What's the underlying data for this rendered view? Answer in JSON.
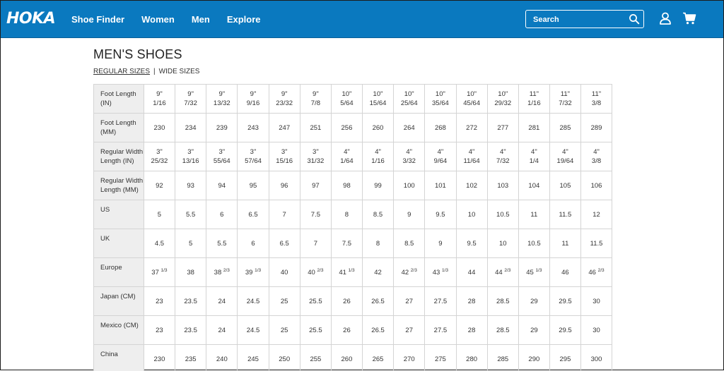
{
  "header": {
    "logo": "HOKA",
    "nav": [
      "Shoe Finder",
      "Women",
      "Men",
      "Explore"
    ],
    "search_placeholder": "Search"
  },
  "page": {
    "title": "MEN'S SHOES",
    "tabs": [
      "REGULAR SIZES",
      "WIDE SIZES"
    ],
    "tab_separator": "|"
  },
  "table": {
    "rows": [
      {
        "label": "Foot Length (IN)",
        "cells": [
          [
            "9\"",
            "1/16"
          ],
          [
            "9\"",
            "7/32"
          ],
          [
            "9\"",
            "13/32"
          ],
          [
            "9\"",
            "9/16"
          ],
          [
            "9\"",
            "23/32"
          ],
          [
            "9\"",
            "7/8"
          ],
          [
            "10\"",
            "5/64"
          ],
          [
            "10\"",
            "15/64"
          ],
          [
            "10\"",
            "25/64"
          ],
          [
            "10\"",
            "35/64"
          ],
          [
            "10\"",
            "45/64"
          ],
          [
            "10\"",
            "29/32"
          ],
          [
            "11\"",
            "1/16"
          ],
          [
            "11\"",
            "7/32"
          ],
          [
            "11\"",
            "3/8"
          ]
        ]
      },
      {
        "label": "Foot Length (MM)",
        "cells": [
          [
            "230"
          ],
          [
            "234"
          ],
          [
            "239"
          ],
          [
            "243"
          ],
          [
            "247"
          ],
          [
            "251"
          ],
          [
            "256"
          ],
          [
            "260"
          ],
          [
            "264"
          ],
          [
            "268"
          ],
          [
            "272"
          ],
          [
            "277"
          ],
          [
            "281"
          ],
          [
            "285"
          ],
          [
            "289"
          ]
        ]
      },
      {
        "label": "Regular Width Length (IN)",
        "cells": [
          [
            "3\"",
            "25/32"
          ],
          [
            "3\"",
            "13/16"
          ],
          [
            "3\"",
            "55/64"
          ],
          [
            "3\"",
            "57/64"
          ],
          [
            "3\"",
            "15/16"
          ],
          [
            "3\"",
            "31/32"
          ],
          [
            "4\"",
            "1/64"
          ],
          [
            "4\"",
            "1/16"
          ],
          [
            "4\"",
            "3/32"
          ],
          [
            "4\"",
            "9/64"
          ],
          [
            "4\"",
            "11/64"
          ],
          [
            "4\"",
            "7/32"
          ],
          [
            "4\"",
            "1/4"
          ],
          [
            "4\"",
            "19/64"
          ],
          [
            "4\"",
            "3/8"
          ]
        ]
      },
      {
        "label": "Regular Width Length (MM)",
        "cells": [
          [
            "92"
          ],
          [
            "93"
          ],
          [
            "94"
          ],
          [
            "95"
          ],
          [
            "96"
          ],
          [
            "97"
          ],
          [
            "98"
          ],
          [
            "99"
          ],
          [
            "100"
          ],
          [
            "101"
          ],
          [
            "102"
          ],
          [
            "103"
          ],
          [
            "104"
          ],
          [
            "105"
          ],
          [
            "106"
          ]
        ]
      },
      {
        "label": "US",
        "cells": [
          [
            "5"
          ],
          [
            "5.5"
          ],
          [
            "6"
          ],
          [
            "6.5"
          ],
          [
            "7"
          ],
          [
            "7.5"
          ],
          [
            "8"
          ],
          [
            "8.5"
          ],
          [
            "9"
          ],
          [
            "9.5"
          ],
          [
            "10"
          ],
          [
            "10.5"
          ],
          [
            "11"
          ],
          [
            "11.5"
          ],
          [
            "12"
          ]
        ]
      },
      {
        "label": "UK",
        "cells": [
          [
            "4.5"
          ],
          [
            "5"
          ],
          [
            "5.5"
          ],
          [
            "6"
          ],
          [
            "6.5"
          ],
          [
            "7"
          ],
          [
            "7.5"
          ],
          [
            "8"
          ],
          [
            "8.5"
          ],
          [
            "9"
          ],
          [
            "9.5"
          ],
          [
            "10"
          ],
          [
            "10.5"
          ],
          [
            "11"
          ],
          [
            "11.5"
          ]
        ]
      },
      {
        "label": "Europe",
        "cells": [
          [
            "37",
            "1/3"
          ],
          [
            "38"
          ],
          [
            "38",
            "2/3"
          ],
          [
            "39",
            "1/3"
          ],
          [
            "40"
          ],
          [
            "40",
            "2/3"
          ],
          [
            "41",
            "1/3"
          ],
          [
            "42"
          ],
          [
            "42",
            "2/3"
          ],
          [
            "43",
            "1/3"
          ],
          [
            "44"
          ],
          [
            "44",
            "2/3"
          ],
          [
            "45",
            "1/3"
          ],
          [
            "46"
          ],
          [
            "46",
            "2/3"
          ]
        ]
      },
      {
        "label": "Japan (CM)",
        "cells": [
          [
            "23"
          ],
          [
            "23.5"
          ],
          [
            "24"
          ],
          [
            "24.5"
          ],
          [
            "25"
          ],
          [
            "25.5"
          ],
          [
            "26"
          ],
          [
            "26.5"
          ],
          [
            "27"
          ],
          [
            "27.5"
          ],
          [
            "28"
          ],
          [
            "28.5"
          ],
          [
            "29"
          ],
          [
            "29.5"
          ],
          [
            "30"
          ]
        ]
      },
      {
        "label": "Mexico (CM)",
        "cells": [
          [
            "23"
          ],
          [
            "23.5"
          ],
          [
            "24"
          ],
          [
            "24.5"
          ],
          [
            "25"
          ],
          [
            "25.5"
          ],
          [
            "26"
          ],
          [
            "26.5"
          ],
          [
            "27"
          ],
          [
            "27.5"
          ],
          [
            "28"
          ],
          [
            "28.5"
          ],
          [
            "29"
          ],
          [
            "29.5"
          ],
          [
            "30"
          ]
        ]
      },
      {
        "label": "China",
        "cells": [
          [
            "230"
          ],
          [
            "235"
          ],
          [
            "240"
          ],
          [
            "245"
          ],
          [
            "250"
          ],
          [
            "255"
          ],
          [
            "260"
          ],
          [
            "265"
          ],
          [
            "270"
          ],
          [
            "275"
          ],
          [
            "280"
          ],
          [
            "285"
          ],
          [
            "290"
          ],
          [
            "295"
          ],
          [
            "300"
          ]
        ]
      }
    ],
    "stacked_rows": [
      0,
      2
    ],
    "superscript_rows": [
      6
    ]
  },
  "colors": {
    "header_bg": "#0a79bf",
    "rowhead_bg": "#eeeeee",
    "border": "#d4d4d4"
  },
  "icons": [
    "search-icon",
    "user-icon",
    "cart-icon"
  ]
}
